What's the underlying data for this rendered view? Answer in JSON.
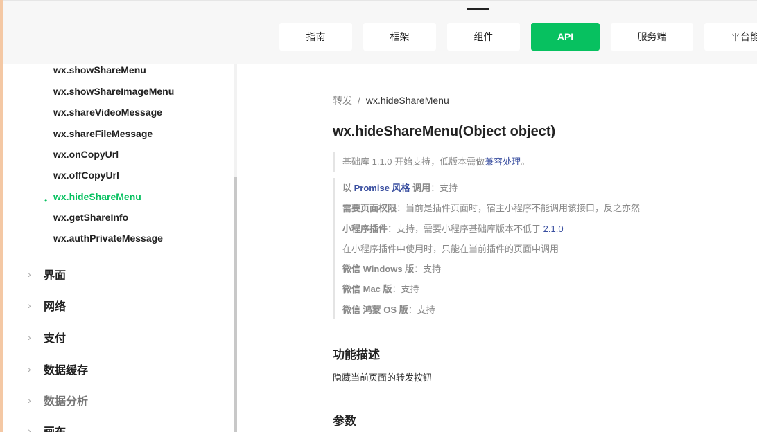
{
  "nav": {
    "buttons": [
      {
        "label": "指南"
      },
      {
        "label": "框架"
      },
      {
        "label": "组件"
      },
      {
        "label": "API"
      },
      {
        "label": "服务端"
      },
      {
        "label": "平台能"
      }
    ],
    "active": "API"
  },
  "sidebar": {
    "api_items": [
      {
        "label": "wx.showShareMenu"
      },
      {
        "label": "wx.showShareImageMenu"
      },
      {
        "label": "wx.shareVideoMessage"
      },
      {
        "label": "wx.shareFileMessage"
      },
      {
        "label": "wx.onCopyUrl"
      },
      {
        "label": "wx.offCopyUrl"
      },
      {
        "label": "wx.hideShareMenu"
      },
      {
        "label": "wx.getShareInfo"
      },
      {
        "label": "wx.authPrivateMessage"
      }
    ],
    "active_item": "wx.hideShareMenu",
    "bullet": "•",
    "chevron": "›",
    "categories": [
      {
        "label": "界面"
      },
      {
        "label": "网络"
      },
      {
        "label": "支付"
      },
      {
        "label": "数据缓存"
      },
      {
        "label": "数据分析"
      },
      {
        "label": "画布"
      }
    ]
  },
  "breadcrumb": {
    "parent": "转发",
    "separator": "/",
    "current": "wx.hideShareMenu"
  },
  "title": "wx.hideShareMenu(Object object)",
  "support": {
    "text": "基础库 1.1.0 开始支持，低版本需做",
    "link": "兼容处理",
    "suffix": "。"
  },
  "details": {
    "promise": {
      "prefix": "以 ",
      "link": "Promise 风格",
      "bold": " 调用",
      "value": "：支持"
    },
    "permission": {
      "label": "需要页面权限",
      "value": "：当前是插件页面时，宿主小程序不能调用该接口，反之亦然"
    },
    "plugin": {
      "label": "小程序插件",
      "value": "：支持，需要小程序基础库版本不低于 ",
      "link": "2.1.0"
    },
    "plugin_note": "在小程序插件中使用时，只能在当前插件的页面中调用",
    "windows": {
      "label": "微信 Windows 版",
      "value": "：支持"
    },
    "mac": {
      "label": "微信 Mac 版",
      "value": "：支持"
    },
    "harmony": {
      "label": "微信 鸿蒙 OS 版",
      "value": "：支持"
    }
  },
  "sections": {
    "description_title": "功能描述",
    "description_text": "隐藏当前页面的转发按钮",
    "params_title": "参数"
  },
  "colors": {
    "accent": "#07c160",
    "link": "#3a4fa0"
  }
}
